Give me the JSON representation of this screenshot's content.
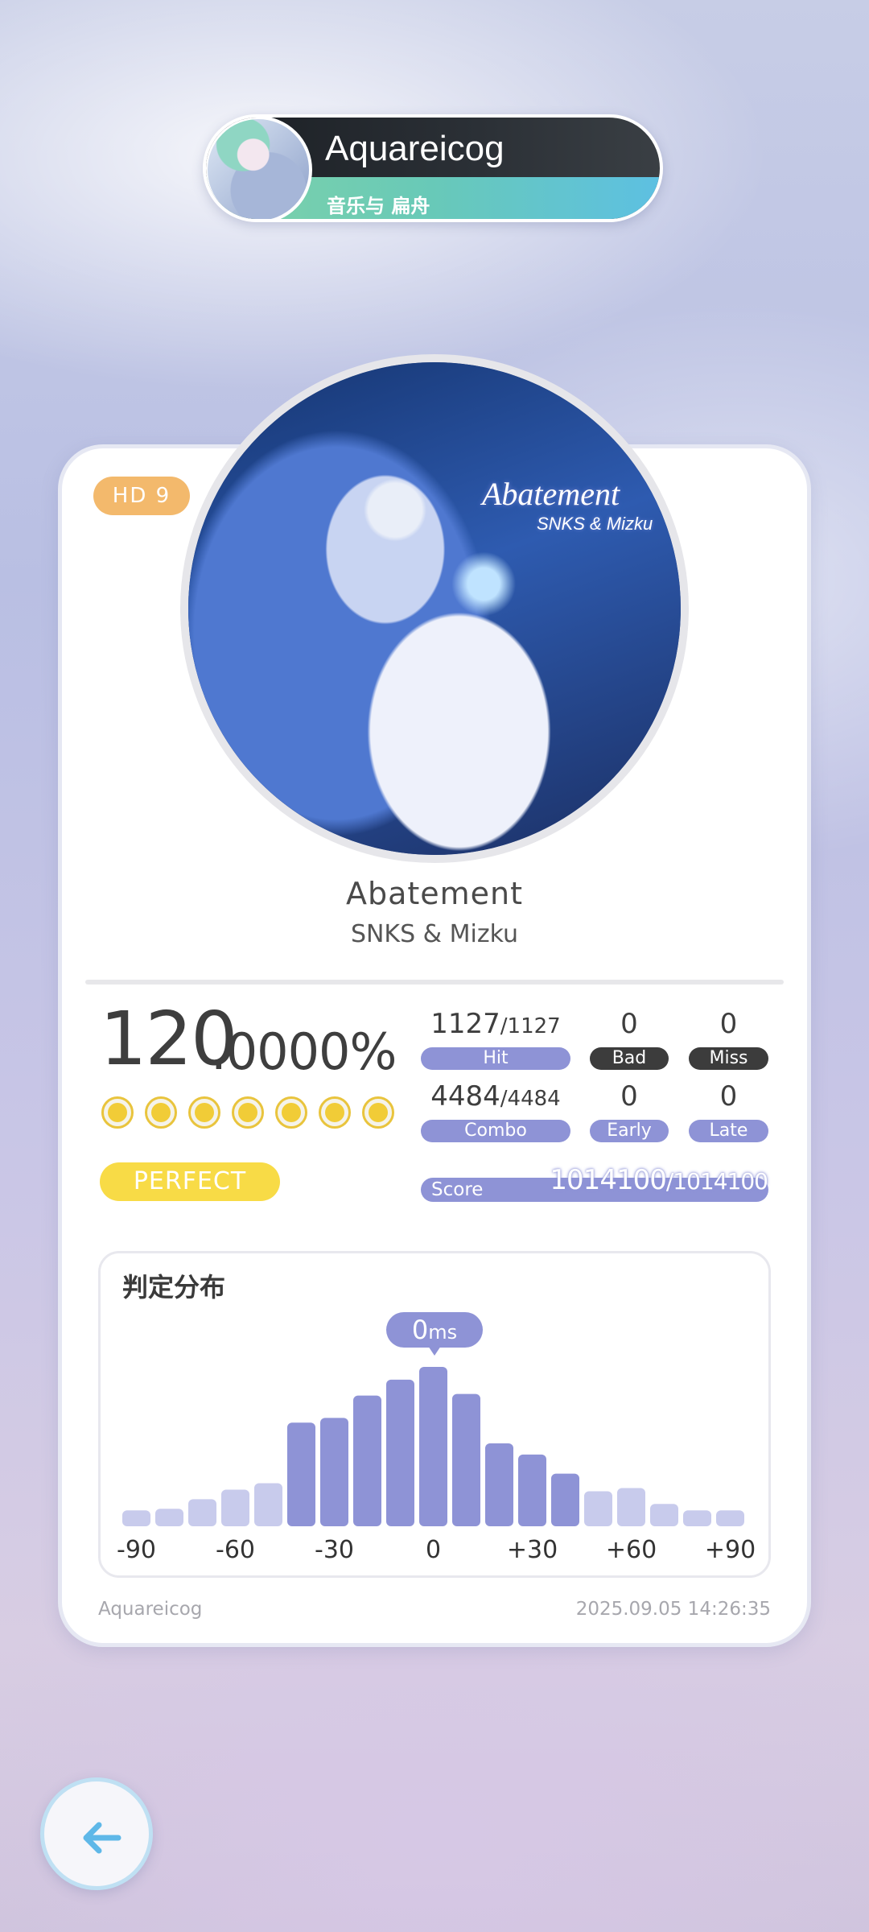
{
  "player": {
    "name": "Aquareicog",
    "subtitle": "音乐与 扁舟"
  },
  "difficulty": {
    "label": "HD 9"
  },
  "song": {
    "cover_title": "Abatement",
    "cover_artist": "SNKS & Mizku",
    "title": "Abatement",
    "artist": "SNKS & Mizku"
  },
  "accuracy": {
    "integer": "120",
    "fraction": ".0000%"
  },
  "rating_label": "PERFECT",
  "stats": {
    "hit": {
      "value": "1127",
      "total": "/1127",
      "label": "Hit"
    },
    "bad": {
      "value": "0",
      "label": "Bad"
    },
    "miss": {
      "value": "0",
      "label": "Miss"
    },
    "combo": {
      "value": "4484",
      "total": "/4484",
      "label": "Combo"
    },
    "early": {
      "value": "0",
      "label": "Early"
    },
    "late": {
      "value": "0",
      "label": "Late"
    },
    "score": {
      "label": "Score",
      "value": "1014100",
      "total": "/1014100"
    }
  },
  "distribution": {
    "title": "判定分布",
    "offset_value": "0",
    "offset_unit": "ms",
    "axis_labels": [
      "-90",
      "-60",
      "-30",
      "0",
      "+30",
      "+60",
      "+90"
    ]
  },
  "chart_data": {
    "type": "bar",
    "title": "判定分布",
    "x": [
      -90,
      -80,
      -70,
      -60,
      -50,
      -40,
      -30,
      -20,
      -10,
      0,
      10,
      20,
      30,
      40,
      50,
      60,
      70,
      80,
      90
    ],
    "values": [
      10,
      11,
      17,
      23,
      27,
      65,
      68,
      82,
      92,
      100,
      83,
      52,
      45,
      33,
      22,
      24,
      14,
      10,
      10
    ],
    "xlabel": "",
    "ylabel": "",
    "accent_color": "#8e93d6",
    "faded_color": "#c8cbec"
  },
  "footer": {
    "player": "Aquareicog",
    "date": "2025.09.05 14:26:35"
  },
  "colors": {
    "accent": "#8e93d6",
    "gold": "#f1cc37",
    "perfect": "#f8db46",
    "difficulty": "#f3b96c"
  },
  "icons": {
    "back": "arrow-left-icon"
  }
}
